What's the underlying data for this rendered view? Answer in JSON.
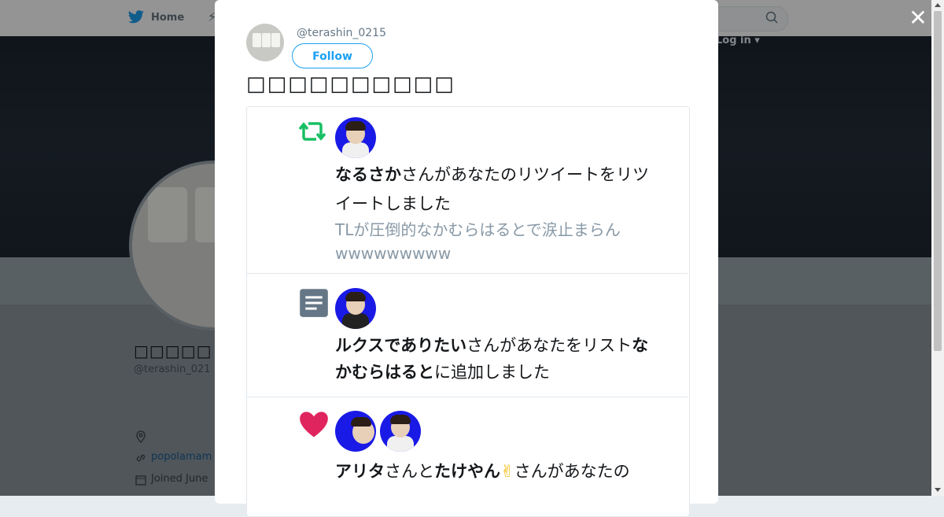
{
  "nav": {
    "home_label": "Home",
    "login_label": "Log in"
  },
  "profile": {
    "display_name": "□□□□□",
    "handle": "@terashin_021",
    "link_text": "popolamam",
    "joined_text": "Joined June"
  },
  "modal": {
    "handle": "@terashin_0215",
    "follow_label": "Follow",
    "tweet_text": "□□□□□□□□□□",
    "close_icon": "close-icon"
  },
  "notifications": [
    {
      "icon": "retweet-icon",
      "icon_color": "#17bf63",
      "user": "なるさか",
      "text_1": "さんがあなたのリツイートをリツ",
      "text_2": "イートしました",
      "sub_1": "TLが圧倒的なかむらはるとで涙止まらん",
      "sub_2": "wwwwwwwww"
    },
    {
      "icon": "list-icon",
      "icon_color": "#657786",
      "user": "ルクスでありたい",
      "text_1": "さんがあなたをリスト",
      "list_1": "な",
      "list_2": "かむらはると",
      "text_2": "に追加しました"
    },
    {
      "icon": "heart-icon",
      "icon_color": "#e0245e",
      "user_1": "アリタ",
      "and": "さんと",
      "user_2": "たけやん",
      "emoji": "✌",
      "text_1": "さんがあなたの"
    }
  ],
  "colors": {
    "accent": "#1da1f2",
    "retweet": "#17bf63",
    "like": "#e0245e"
  }
}
